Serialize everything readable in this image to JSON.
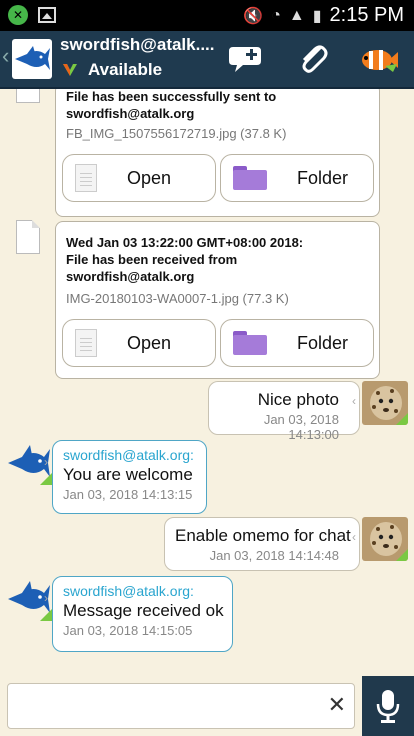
{
  "status_bar": {
    "time": "2:15 PM"
  },
  "header": {
    "contact": "swordfish@atalk....",
    "presence": "Available"
  },
  "messages": {
    "file1": {
      "text_line1": "File has been successfully sent to",
      "text_line2": "swordfish@atalk.org",
      "meta": "FB_IMG_1507556172719.jpg (37.8 K)",
      "open_label": "Open",
      "folder_label": "Folder"
    },
    "file2": {
      "text_line1": "Wed Jan 03 13:22:00 GMT+08:00 2018:",
      "text_line2": "File has been received from",
      "text_line3": "swordfish@atalk.org",
      "meta": "IMG-20180103-WA0007-1.jpg (77.3 K)",
      "open_label": "Open",
      "folder_label": "Folder"
    },
    "m1": {
      "text": "Nice photo",
      "time": "Jan 03, 2018 14:13:00"
    },
    "m2": {
      "sender": "swordfish@atalk.org:",
      "text": "You are welcome",
      "time": "Jan 03, 2018 14:13:15"
    },
    "m3": {
      "text": "Enable omemo for chat",
      "time": "Jan 03, 2018 14:14:48"
    },
    "m4": {
      "sender": "swordfish@atalk.org:",
      "text": "Message received ok",
      "time": "Jan 03, 2018 14:15:05"
    }
  },
  "input": {
    "placeholder": "",
    "value": ""
  },
  "colors": {
    "header_bg": "#1f3a4f",
    "chat_bg": "#f7f1e0",
    "sender_blue": "#2aa5cf",
    "presence_green": "#7ac943"
  }
}
